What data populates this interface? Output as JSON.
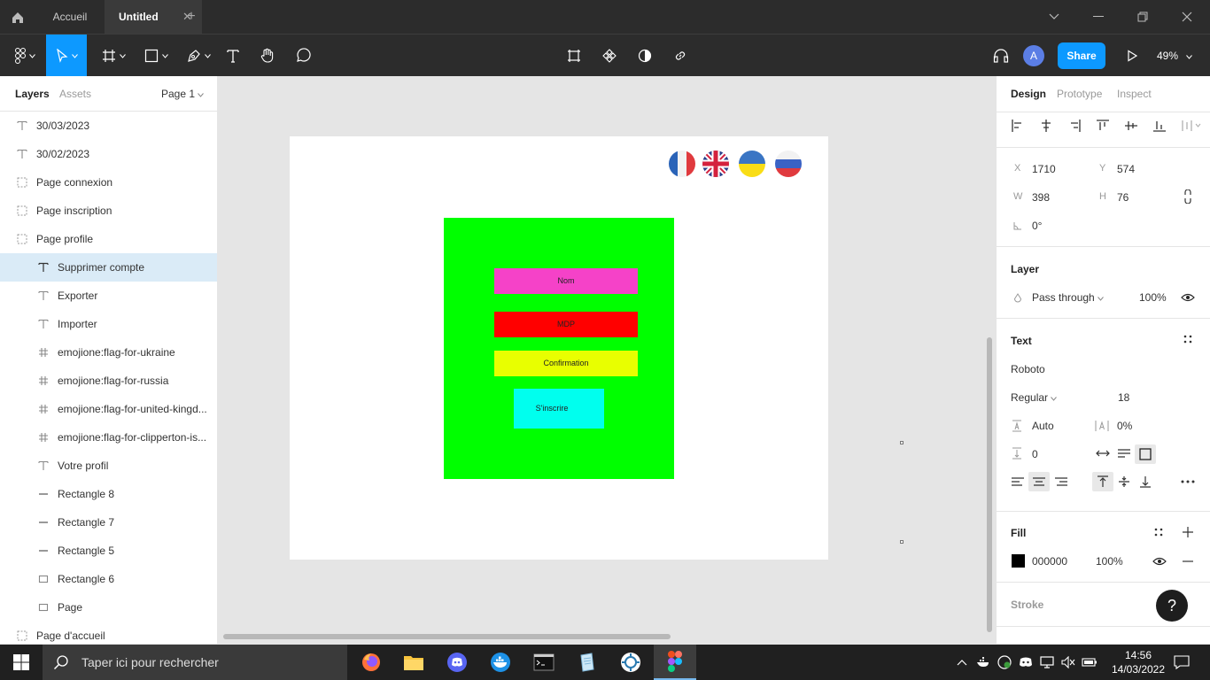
{
  "titlebar": {
    "tabs": [
      {
        "label": "Accueil"
      },
      {
        "label": "Untitled"
      }
    ]
  },
  "toolbar": {
    "share_label": "Share",
    "avatar_initial": "A",
    "zoom": "49%"
  },
  "left_panel": {
    "tabs": {
      "layers": "Layers",
      "assets": "Assets",
      "page": "Page 1"
    },
    "layers": [
      {
        "label": "30/03/2023",
        "icon": "text-icon"
      },
      {
        "label": "30/02/2023",
        "icon": "text-icon"
      },
      {
        "label": "Page connexion",
        "icon": "frame-icon"
      },
      {
        "label": "Page inscription",
        "icon": "frame-icon"
      },
      {
        "label": "Page profile",
        "icon": "frame-icon"
      },
      {
        "label": "Supprimer compte",
        "icon": "text-icon",
        "selected": true
      },
      {
        "label": "Exporter",
        "icon": "text-icon"
      },
      {
        "label": "Importer",
        "icon": "text-icon"
      },
      {
        "label": "emojione:flag-for-ukraine",
        "icon": "hash-icon"
      },
      {
        "label": "emojione:flag-for-russia",
        "icon": "hash-icon"
      },
      {
        "label": "emojione:flag-for-united-kingd...",
        "icon": "hash-icon"
      },
      {
        "label": "emojione:flag-for-clipperton-is...",
        "icon": "hash-icon"
      },
      {
        "label": "Votre profil",
        "icon": "text-icon"
      },
      {
        "label": "Rectangle 8",
        "icon": "line-icon"
      },
      {
        "label": "Rectangle 7",
        "icon": "line-icon"
      },
      {
        "label": "Rectangle 5",
        "icon": "line-icon"
      },
      {
        "label": "Rectangle 6",
        "icon": "rect-icon"
      },
      {
        "label": "Page",
        "icon": "rect-icon"
      },
      {
        "label": "Page d'accueil",
        "icon": "frame-icon"
      }
    ]
  },
  "canvas": {
    "fields": {
      "nom": "Nom",
      "mdp": "MDP",
      "confirmation": "Confirmation",
      "sinscrire": "S'inscrire"
    },
    "colors": {
      "green": "#00ff00",
      "nom": "#f542c8",
      "mdp": "#ff0000",
      "confirmation": "#e8ff00",
      "sinscrire": "#00ffee"
    }
  },
  "right_panel": {
    "tabs": {
      "design": "Design",
      "prototype": "Prototype",
      "inspect": "Inspect"
    },
    "x_label": "X",
    "x": "1710",
    "y_label": "Y",
    "y": "574",
    "w_label": "W",
    "w": "398",
    "h_label": "H",
    "h": "76",
    "rotation": "0°",
    "layer": {
      "title": "Layer",
      "blend": "Pass through",
      "opacity": "100%"
    },
    "text": {
      "title": "Text",
      "font": "Roboto",
      "weight": "Regular",
      "size": "18",
      "line_height": "Auto",
      "letter_spacing": "0%",
      "paragraph_spacing": "0"
    },
    "fill": {
      "title": "Fill",
      "hex": "000000",
      "opacity": "100%",
      "swatch": "#000000"
    },
    "stroke": {
      "title": "Stroke"
    },
    "help": "?"
  },
  "taskbar": {
    "search_placeholder": "Taper ici pour rechercher",
    "time": "14:56",
    "date": "14/03/2022"
  }
}
